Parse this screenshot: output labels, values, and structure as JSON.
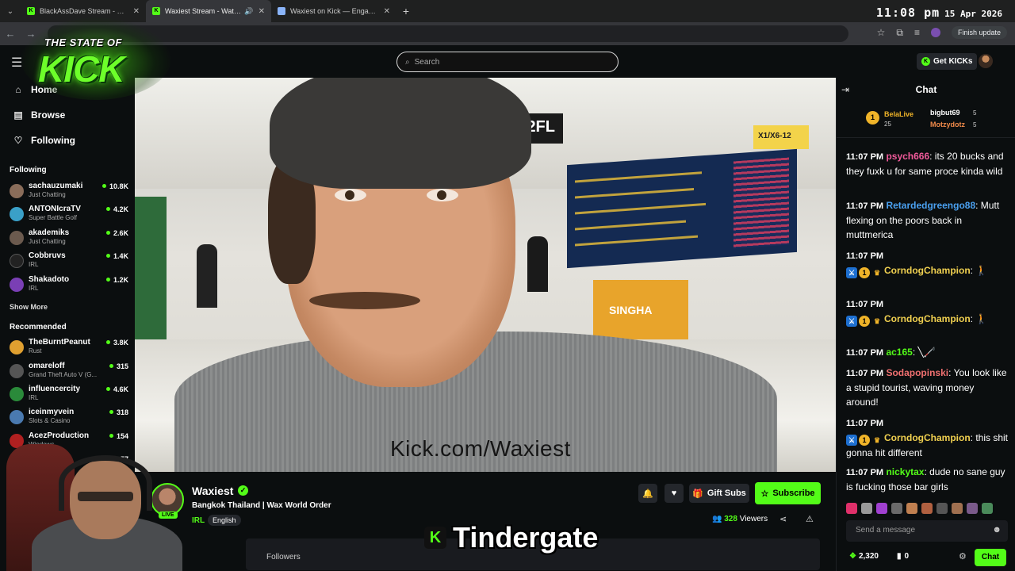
{
  "browser": {
    "tabs": [
      {
        "title": "BlackAssDave Stream - Watch Li",
        "active": false
      },
      {
        "title": "Waxiest Stream - Watch Liv",
        "active": true
      },
      {
        "title": "Waxiest on Kick — Engagemen",
        "active": false
      }
    ],
    "clock_time": "11:08 pm",
    "clock_date": "15 Apr 2026",
    "finish_update_label": "Finish update"
  },
  "overlay": {
    "logo_line1": "THE STATE OF",
    "logo_line2": "KICK",
    "caption": "Tindergate"
  },
  "topnav": {
    "search_placeholder": "Search",
    "get_kicks_label": "Get KICKs"
  },
  "sidebar": {
    "nav": [
      {
        "label": "Home",
        "icon": "home-icon"
      },
      {
        "label": "Browse",
        "icon": "browse-icon"
      },
      {
        "label": "Following",
        "icon": "heart-icon"
      }
    ],
    "following_header": "Following",
    "following": [
      {
        "name": "sachauzumaki",
        "category": "Just Chatting",
        "viewers": "10.8K",
        "color": "#8a6d5a"
      },
      {
        "name": "ANTONIcraTV",
        "category": "Super Battle Golf",
        "viewers": "4.2K",
        "color": "#3aa0c8"
      },
      {
        "name": "akademiks",
        "category": "Just Chatting",
        "viewers": "2.6K",
        "color": "#6b5a4e"
      },
      {
        "name": "Cobbruvs",
        "category": "IRL",
        "viewers": "1.4K",
        "color": "#222"
      },
      {
        "name": "Shakadoto",
        "category": "IRL",
        "viewers": "1.2K",
        "color": "#7a3fb5"
      }
    ],
    "show_more": "Show More",
    "recommended_header": "Recommended",
    "recommended": [
      {
        "name": "TheBurntPeanut",
        "category": "Rust",
        "viewers": "3.8K",
        "color": "#e0a030"
      },
      {
        "name": "omareloff",
        "category": "Grand Theft Auto V (G...",
        "viewers": "315",
        "color": "#555"
      },
      {
        "name": "influencercity",
        "category": "IRL",
        "viewers": "4.6K",
        "color": "#2a8a3a"
      },
      {
        "name": "iceinmyvein",
        "category": "Slots & Casino",
        "viewers": "318",
        "color": "#4a7ab0"
      },
      {
        "name": "AcezProduction",
        "category": "Windows",
        "viewers": "154",
        "color": "#b02020"
      },
      {
        "name": "Fo...",
        "category": "",
        "viewers": "57",
        "color": "#888"
      }
    ]
  },
  "video": {
    "watermark": "Kick.com/Waxiest",
    "sign_floor": "2FL",
    "sign_gate": "X1/X6-12",
    "sign_brand": "SINGHA"
  },
  "stream": {
    "channel_name": "Waxiest",
    "live_label": "LIVE",
    "title": "Bangkok Thailand | Wax World Order",
    "category": "IRL",
    "language": "English",
    "gift_subs_label": "Gift Subs",
    "subscribe_label": "Subscribe",
    "viewer_count": "328",
    "viewers_label": "Viewers",
    "followers_label": "Followers"
  },
  "chat": {
    "title": "Chat",
    "leaders": [
      {
        "name": "BelaLive",
        "count": "25",
        "color": "#f0b429"
      },
      {
        "name": "bigbut69",
        "count": "5",
        "color": "#ffffff"
      },
      {
        "name": "Motzydotz",
        "count": "5",
        "color": "#f08a4a"
      }
    ],
    "messages": [
      {
        "time": "11:07 PM",
        "user": "psych666",
        "color": "#f05a9a",
        "text": ": its 20 bucks and they fuxk u for same proce kinda wild"
      },
      {
        "time": "11:07 PM",
        "user": "Retardedgreengo88",
        "color": "#4aa0f0",
        "text": ": Mutt flexing on the poors back in muttmerica"
      },
      {
        "time": "11:07 PM",
        "user": "CorndogChampion",
        "color": "#f0d050",
        "text": ": 🚶"
      },
      {
        "time": "11:07 PM",
        "user": "CorndogChampion",
        "color": "#f0d050",
        "text": ": 🚶"
      },
      {
        "time": "11:07 PM",
        "user": "ac165",
        "color": "#53fc18",
        "text": ": ╲🦯"
      },
      {
        "time": "11:07 PM",
        "user": "Sodapopinski",
        "color": "#f07070",
        "text": ": You look like a stupid tourist, waving money around!"
      },
      {
        "time": "11:07 PM",
        "user": "CorndogChampion",
        "color": "#f0d050",
        "text": ": this shit gonna hit different"
      },
      {
        "time": "11:07 PM",
        "user": "nickytax",
        "color": "#53fc18",
        "text": ": dude no sane guy is fucking those bar girls"
      }
    ],
    "input_placeholder": "Send a message",
    "points": "2,320",
    "points2": "0",
    "chat_button": "Chat"
  }
}
